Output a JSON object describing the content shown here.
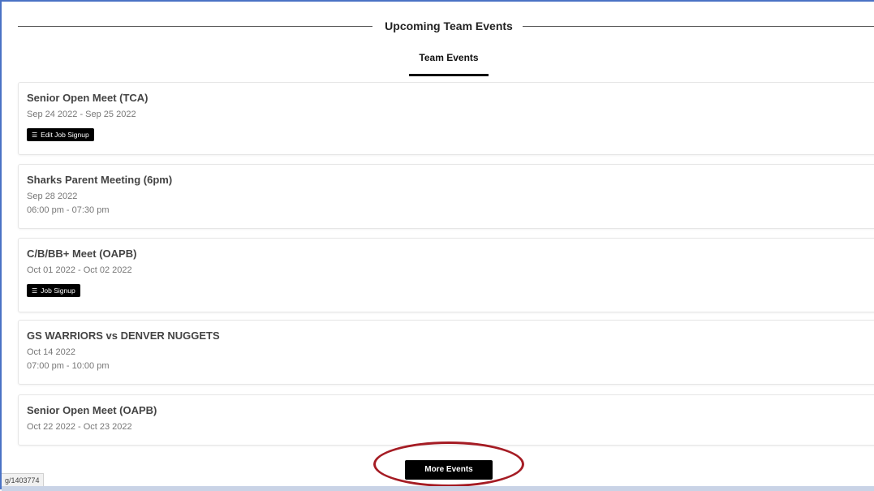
{
  "header": {
    "title": "Upcoming Team Events"
  },
  "tabs": [
    {
      "label": "Team Events",
      "active": true
    }
  ],
  "events": [
    {
      "title": "Senior Open Meet (TCA)",
      "lines": [
        "Sep 24 2022  -  Sep 25 2022"
      ],
      "button": "Edit Job Signup"
    },
    {
      "title": "Sharks Parent Meeting (6pm)",
      "lines": [
        "Sep 28 2022",
        "06:00 pm  -  07:30 pm"
      ]
    },
    {
      "title": "C/B/BB+ Meet (OAPB)",
      "lines": [
        "Oct 01 2022  -  Oct 02 2022"
      ],
      "button": "Job Signup"
    },
    {
      "title": "GS WARRIORS vs DENVER NUGGETS",
      "lines": [
        "Oct 14 2022",
        "07:00 pm  -  10:00 pm"
      ]
    },
    {
      "title": "Senior Open Meet (OAPB)",
      "lines": [
        "Oct 22 2022  -  Oct 23 2022"
      ]
    }
  ],
  "more_button": {
    "label": "More Events"
  },
  "status_url": "g/1403774",
  "colors": {
    "frame_border": "#4a72c4",
    "highlight": "#a51c24",
    "button_bg": "#000000"
  },
  "icons": {
    "signup_icon": "sliders-icon"
  }
}
